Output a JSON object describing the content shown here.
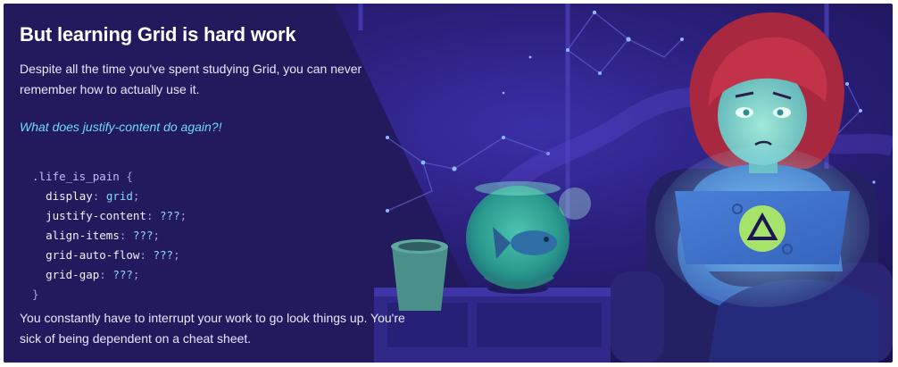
{
  "headline": "But learning Grid is hard work",
  "intro": "Despite all the time you've spent studying Grid, you can never remember how to actually use it.",
  "question": "What does justify-content do again?!",
  "code": {
    "selector": ".life_is_pain",
    "open_brace": "{",
    "close_brace": "}",
    "declarations": [
      {
        "property": "display",
        "value": "grid"
      },
      {
        "property": "justify-content",
        "value": "???"
      },
      {
        "property": "align-items",
        "value": "???"
      },
      {
        "property": "grid-auto-flow",
        "value": "???"
      },
      {
        "property": "grid-gap",
        "value": "???"
      }
    ]
  },
  "outro": "You constantly have to interrupt your work to go look things up. You're sick of being dependent on a cheat sheet.",
  "colors": {
    "background": "#1d1557",
    "accent_cyan": "#6fd9ff",
    "laptop_logo": "#a6e36a"
  }
}
